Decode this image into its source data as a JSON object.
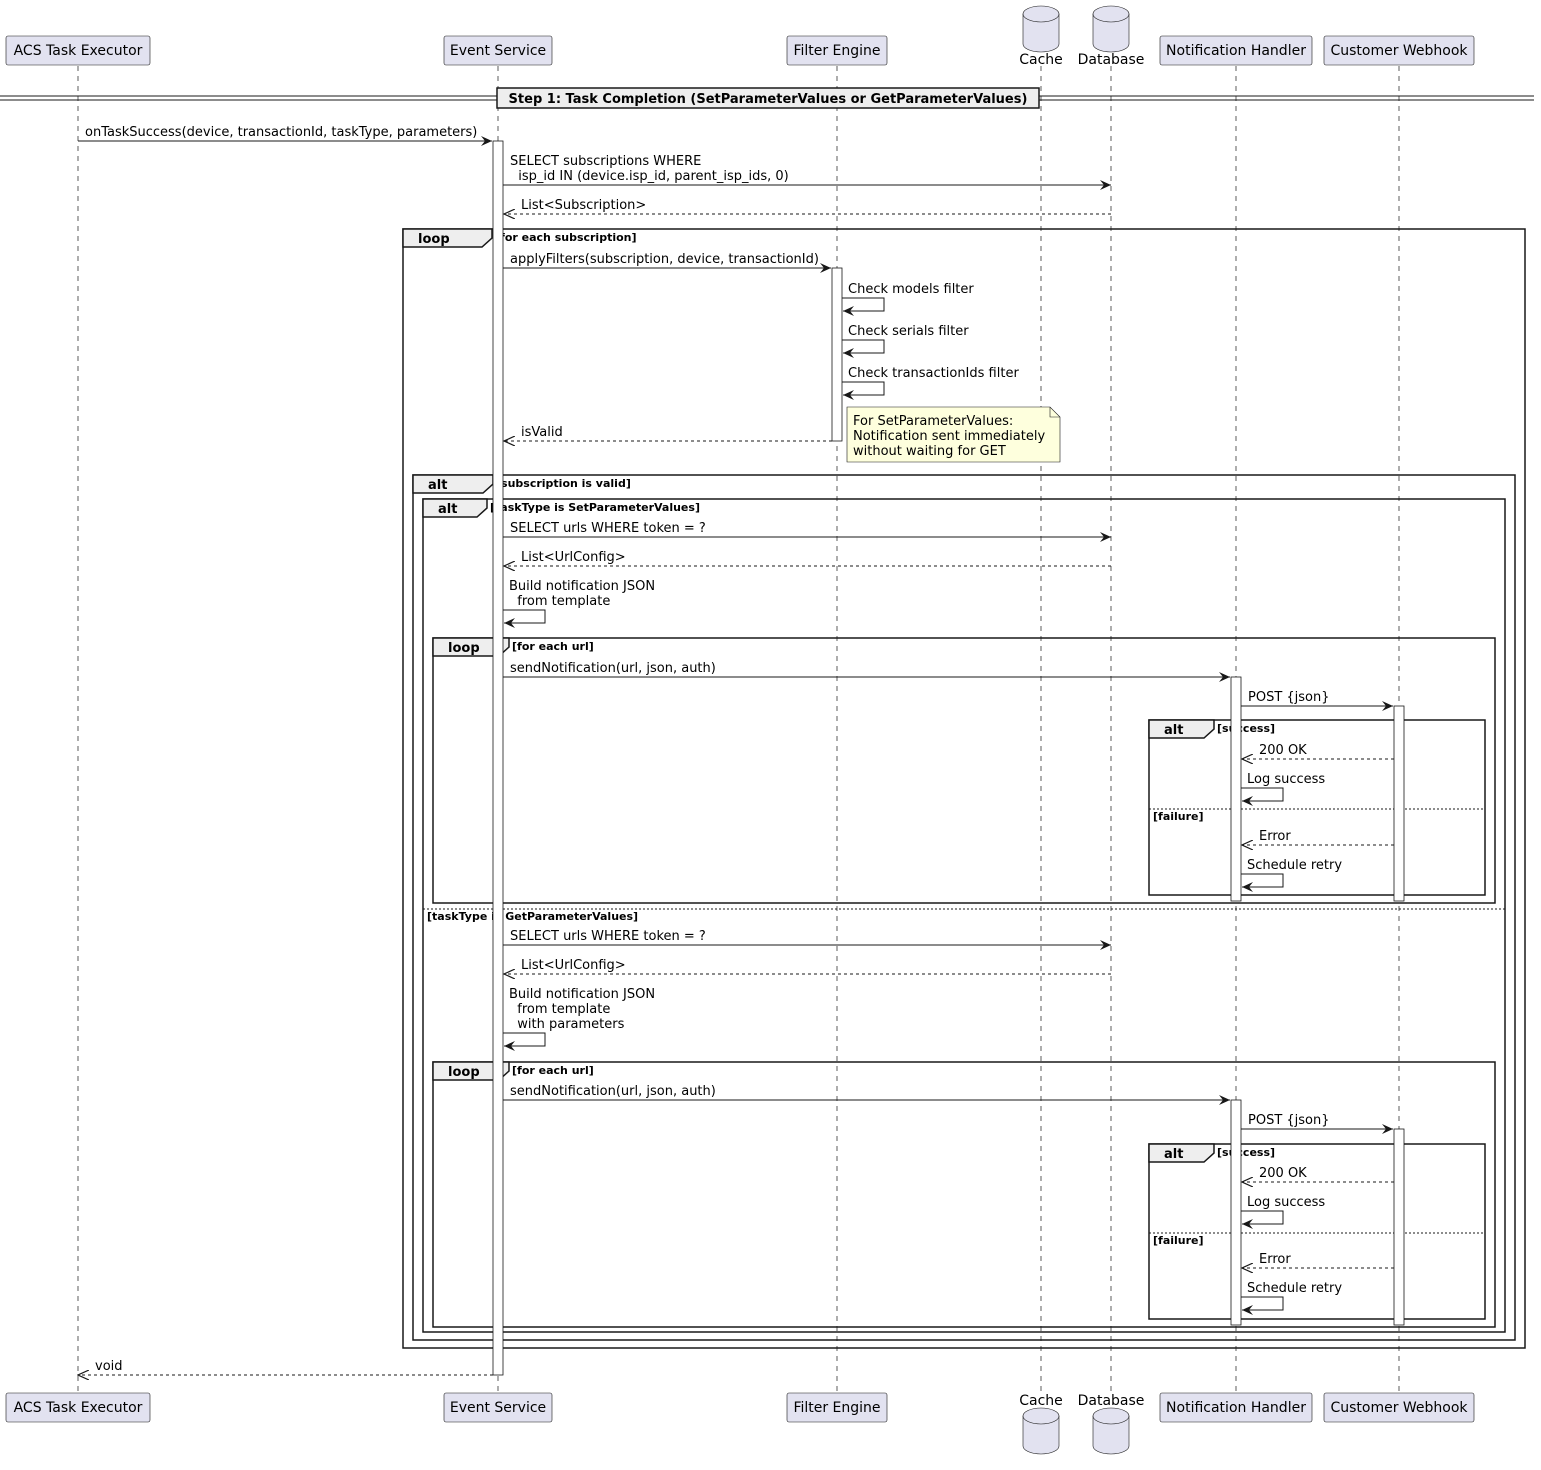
{
  "participants": [
    {
      "id": "executor",
      "label": "ACS Task Executor",
      "kind": "box"
    },
    {
      "id": "event",
      "label": "Event Service",
      "kind": "box"
    },
    {
      "id": "filter",
      "label": "Filter Engine",
      "kind": "box"
    },
    {
      "id": "cache",
      "label": "Cache",
      "kind": "database"
    },
    {
      "id": "db",
      "label": "Database",
      "kind": "database"
    },
    {
      "id": "notif",
      "label": "Notification Handler",
      "kind": "box"
    },
    {
      "id": "webhook",
      "label": "Customer Webhook",
      "kind": "box"
    }
  ],
  "divider": "Step 1: Task Completion (SetParameterValues or GetParameterValues)",
  "messages": {
    "m1": "onTaskSuccess(device, transactionId, taskType, parameters)",
    "m2": [
      "SELECT subscriptions WHERE",
      "  isp_id IN (device.isp_id, parent_isp_ids, 0)"
    ],
    "m3": "List<Subscription>",
    "m4": "applyFilters(subscription, device, transactionId)",
    "m5": "Check models filter",
    "m6": "Check serials filter",
    "m7": "Check transactionIds filter",
    "m8": "isValid",
    "a1": "SELECT urls WHERE token = ?",
    "a2": "List<UrlConfig>",
    "a3": [
      "Build notification JSON",
      "  from template"
    ],
    "a4": "sendNotification(url, json, auth)",
    "a5": "POST {json}",
    "a6": "200 OK",
    "a7": "Log success",
    "a8": "Error",
    "a9": "Schedule retry",
    "b1": "SELECT urls WHERE token = ?",
    "b2": "List<UrlConfig>",
    "b3": [
      "Build notification JSON",
      "  from template",
      "  with parameters"
    ],
    "b4": "sendNotification(url, json, auth)",
    "b5": "POST {json}",
    "b6": "200 OK",
    "b7": "Log success",
    "b8": "Error",
    "b9": "Schedule retry",
    "ret": "void"
  },
  "note": [
    "For SetParameterValues:",
    "Notification sent immediately",
    "without waiting for GET"
  ],
  "frames": {
    "loop_sub": {
      "kw": "loop",
      "guard": "[for each subscription]"
    },
    "alt_valid": {
      "kw": "alt",
      "guard": "[subscription is valid]"
    },
    "alt_task": {
      "kw": "alt",
      "guard": "[taskType is SetParameterValues]",
      "else": "[taskType is GetParameterValues]"
    },
    "loop_url1": {
      "kw": "loop",
      "guard": "[for each url]"
    },
    "alt_res1": {
      "kw": "alt",
      "guard": "[success]",
      "else": "[failure]"
    },
    "loop_url2": {
      "kw": "loop",
      "guard": "[for each url]"
    },
    "alt_res2": {
      "kw": "alt",
      "guard": "[success]",
      "else": "[failure]"
    }
  },
  "colors": {
    "participant_fill": "#e2e2f0",
    "participant_stroke": "#181818",
    "note_fill": "#feffdd"
  }
}
